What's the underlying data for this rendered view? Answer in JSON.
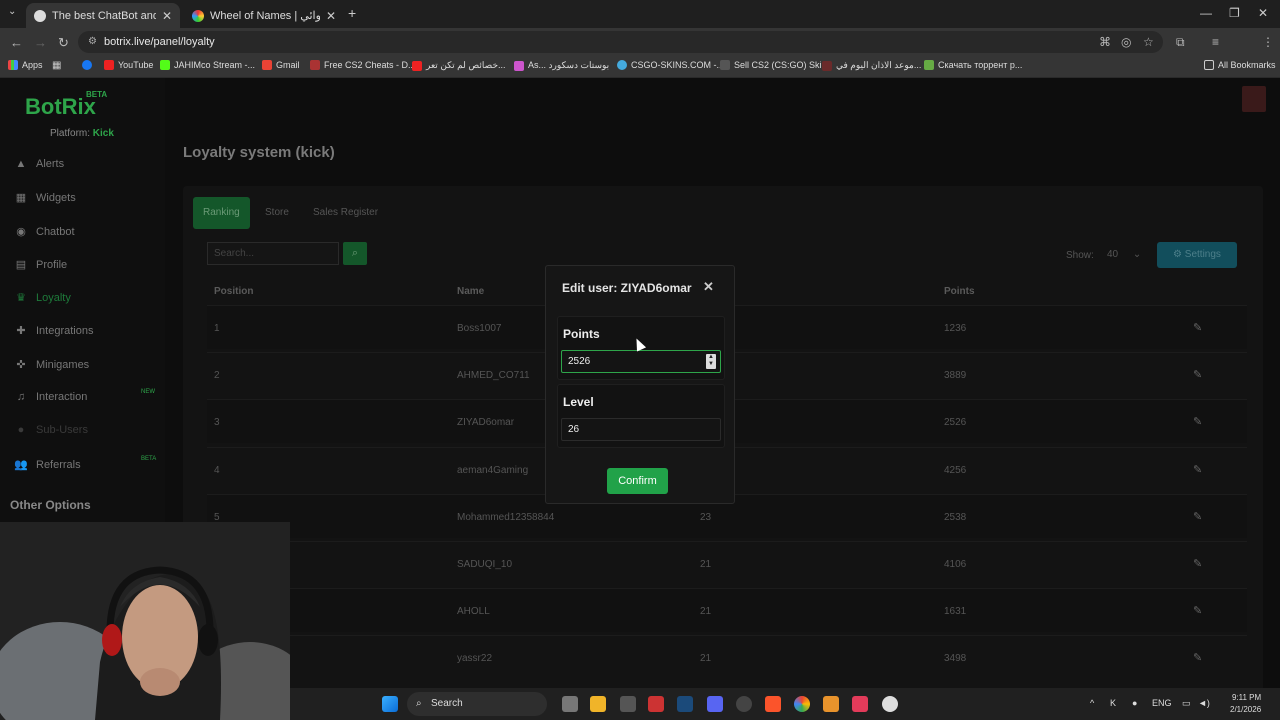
{
  "browser": {
    "tabs": [
      {
        "title": "The best ChatBot and Widgets",
        "active": true,
        "close": "✕"
      },
      {
        "title": "Wheel of Names | اسم العشوائي",
        "active": false,
        "close": "✕"
      }
    ],
    "new_tab": "+",
    "url": "botrix.live/panel/loyalty",
    "bookmarks": [
      "Apps",
      "YouTube",
      "JAHIMco Stream -...",
      "Gmail",
      "Free CS2 Cheats - D...",
      "خصائص لم تكن تعر...",
      "As... بوستات دسكورد",
      "CSGO-SKINS.COM -...",
      "Sell CS2 (CS:GO) Ski...",
      "موعد الاذان اليوم في...",
      "Скачать торрент р..."
    ],
    "all_bookmarks": "All Bookmarks"
  },
  "sidebar": {
    "logo": "BotRix",
    "logo_badge": "BETA",
    "platform_label": "Platform:",
    "platform_value": "Kick",
    "items": [
      {
        "label": "Alerts",
        "icon": "warning-icon"
      },
      {
        "label": "Widgets",
        "icon": "grid-icon"
      },
      {
        "label": "Chatbot",
        "icon": "robot-icon"
      },
      {
        "label": "Profile",
        "icon": "id-card-icon"
      },
      {
        "label": "Loyalty",
        "icon": "trophy-icon"
      },
      {
        "label": "Integrations",
        "icon": "puzzle-icon"
      },
      {
        "label": "Minigames",
        "icon": "gamepad-icon"
      },
      {
        "label": "Interaction",
        "icon": "music-icon",
        "badge": "NEW"
      },
      {
        "label": "Sub-Users",
        "icon": "user-icon"
      },
      {
        "label": "Referrals",
        "icon": "users-icon",
        "badge": "BETA"
      }
    ],
    "other_options": "Other Options"
  },
  "main": {
    "title": "Loyalty system (kick)",
    "tabs": [
      "Ranking",
      "Store",
      "Sales Register"
    ],
    "search_placeholder": "Search...",
    "show_label": "Show:",
    "show_value": "40",
    "settings_label": "Settings",
    "columns": [
      "Position",
      "Name",
      "Points"
    ],
    "rows": [
      {
        "position": "1",
        "name": "Boss1007",
        "level": "",
        "points": "1236"
      },
      {
        "position": "2",
        "name": "AHMED_CO711",
        "level": "",
        "points": "3889"
      },
      {
        "position": "3",
        "name": "ZIYAD6omar",
        "level": "",
        "points": "2526"
      },
      {
        "position": "4",
        "name": "aeman4Gaming",
        "level": "",
        "points": "4256"
      },
      {
        "position": "5",
        "name": "Mohammed12358844",
        "level": "23",
        "points": "2538"
      },
      {
        "position": "",
        "name": "SADUQI_10",
        "level": "21",
        "points": "4106"
      },
      {
        "position": "",
        "name": "AHOLL",
        "level": "21",
        "points": "1631"
      },
      {
        "position": "",
        "name": "yassr22",
        "level": "21",
        "points": "3498"
      }
    ]
  },
  "modal": {
    "title": "Edit user: ZIYAD6omar",
    "close": "✕",
    "points_label": "Points",
    "points_value": "2526",
    "level_label": "Level",
    "level_value": "26",
    "confirm": "Confirm"
  },
  "taskbar": {
    "search": "Search",
    "lang": "ENG",
    "time": "9:11 PM",
    "date": "2/1/2026"
  },
  "colors": {
    "accent": "#21a249",
    "settings": "#124e5c"
  }
}
